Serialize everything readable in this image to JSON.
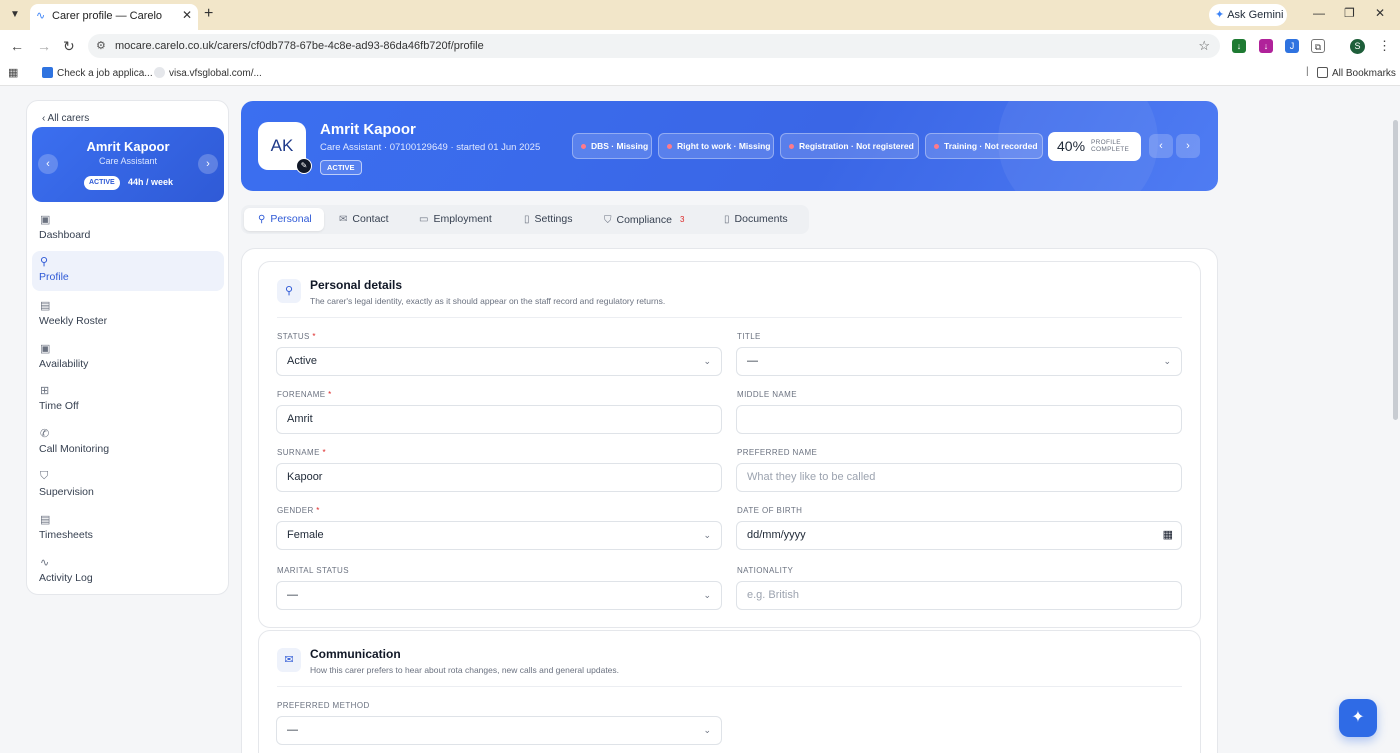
{
  "browser": {
    "tab_title": "Carer profile — Carelo",
    "url": "mocare.carelo.co.uk/carers/cf0db778-67be-4c8e-ad93-86da46fb720f/profile",
    "ask_gemini": "Ask Gemini",
    "profile_initial": "S",
    "bookmarks": [
      {
        "label": "Check a job applica..."
      },
      {
        "label": "visa.vfsglobal.com/..."
      }
    ],
    "all_bookmarks": "All Bookmarks"
  },
  "sidebar": {
    "back_label": "‹ All carers",
    "name": "Amrit Kapoor",
    "role": "Care Assistant",
    "status_chip": "ACTIVE",
    "hours": "44h / week",
    "items": [
      {
        "label": "Dashboard",
        "icon": "calendar-icon"
      },
      {
        "label": "Profile",
        "icon": "user-icon"
      },
      {
        "label": "Weekly Roster",
        "icon": "roster-icon"
      },
      {
        "label": "Availability",
        "icon": "calendar-check-icon"
      },
      {
        "label": "Time Off",
        "icon": "calendar-plus-icon"
      },
      {
        "label": "Call Monitoring",
        "icon": "phone-icon"
      },
      {
        "label": "Supervision",
        "icon": "shield-icon"
      },
      {
        "label": "Timesheets",
        "icon": "document-icon"
      },
      {
        "label": "Activity Log",
        "icon": "pulse-icon"
      }
    ]
  },
  "hero": {
    "initials": "AK",
    "name": "Amrit Kapoor",
    "subtitle": "Care Assistant · 07100129649 · started 01 Jun 2025",
    "status": "ACTIVE",
    "pills": [
      {
        "label": "DBS · Missing"
      },
      {
        "label": "Right to work · Missing"
      },
      {
        "label": "Registration · Not registered"
      },
      {
        "label": "Training · Not recorded"
      }
    ],
    "completion_percent": "40%",
    "completion_label_1": "PROFILE",
    "completion_label_2": "COMPLETE",
    "completion_value": 40
  },
  "tabs": [
    {
      "label": "Personal",
      "active": true
    },
    {
      "label": "Contact"
    },
    {
      "label": "Employment"
    },
    {
      "label": "Settings"
    },
    {
      "label": "Compliance",
      "badge": "3"
    },
    {
      "label": "Documents"
    }
  ],
  "personal": {
    "title": "Personal details",
    "description": "The carer's legal identity, exactly as it should appear on the staff record and regulatory returns.",
    "fields": {
      "status": {
        "label": "STATUS",
        "value": "Active"
      },
      "title": {
        "label": "TITLE",
        "value": "—"
      },
      "forename": {
        "label": "FORENAME",
        "value": "Amrit"
      },
      "middle_name": {
        "label": "MIDDLE NAME",
        "value": ""
      },
      "surname": {
        "label": "SURNAME",
        "value": "Kapoor"
      },
      "preferred_name": {
        "label": "PREFERRED NAME",
        "placeholder": "What they like to be called"
      },
      "gender": {
        "label": "GENDER",
        "value": "Female"
      },
      "dob": {
        "label": "DATE OF BIRTH",
        "value": "dd/mm/yyyy"
      },
      "marital_status": {
        "label": "MARITAL STATUS",
        "value": "—"
      },
      "nationality": {
        "label": "NATIONALITY",
        "placeholder": "e.g. British"
      }
    },
    "required_mark": "*"
  },
  "communication": {
    "title": "Communication",
    "description": "How this carer prefers to hear about rota changes, new calls and general updates.",
    "preferred_method": {
      "label": "PREFERRED METHOD",
      "value": "—"
    }
  },
  "colors": {
    "accent": "#2f5ad6",
    "hero": "#3b6ff0",
    "danger": "#dc2626"
  }
}
